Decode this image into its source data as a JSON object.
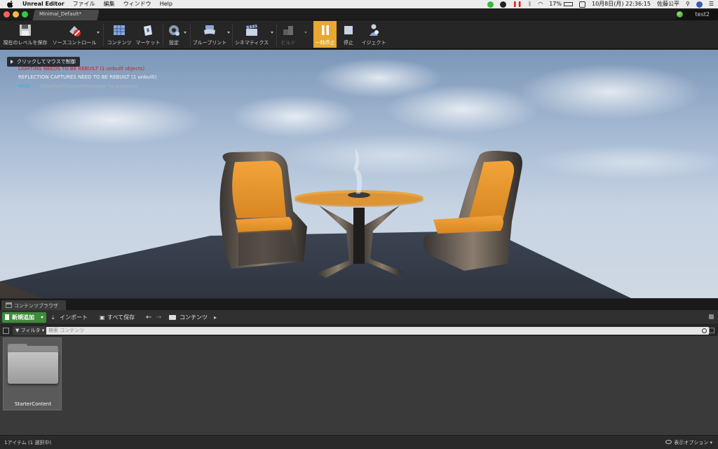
{
  "menubar": {
    "app_name": "Unreal Editor",
    "menus": [
      "ファイル",
      "編集",
      "ウィンドウ",
      "Help"
    ],
    "battery": "17%",
    "datetime": "10月8日(月) 22:36:15",
    "user": "佐藤公平"
  },
  "window": {
    "document_tab": "Minimal_Default*",
    "project_name": "test2"
  },
  "toolbar": {
    "save_level": "現在のレベルを保存",
    "source_control": "ソースコントロール",
    "content": "コンテンツ",
    "marketplace": "マーケット",
    "settings": "設定",
    "blueprints": "ブループリント",
    "cinematics": "シネマティクス",
    "build": "ビルド",
    "pause": "一時停止",
    "stop": "停止",
    "eject": "イジェクト"
  },
  "viewport": {
    "click_hint": "クリックしてマウスで制御",
    "messages": {
      "lighting": "LIGHTING NEEDS TO BE REBUILT (1 unbuilt objects)",
      "reflection": "REFLECTION CAPTURES NEED TO BE REBUILT (1 unbuilt)",
      "hello": "Hello",
      "suppress": "'DisableAllScreenMessages' to suppress"
    }
  },
  "content_browser": {
    "tab_label": "コンテンツブラウザ",
    "add_new": "新規追加",
    "import": "インポート",
    "save_all": "すべて保存",
    "path": "コンテンツ",
    "filters": "フィルタ",
    "search_placeholder": "検索 コンテンツ",
    "assets": [
      {
        "name": "StarterContent"
      }
    ],
    "status": "1アイテム (1 選択中)",
    "view_options": "表示オプション"
  }
}
